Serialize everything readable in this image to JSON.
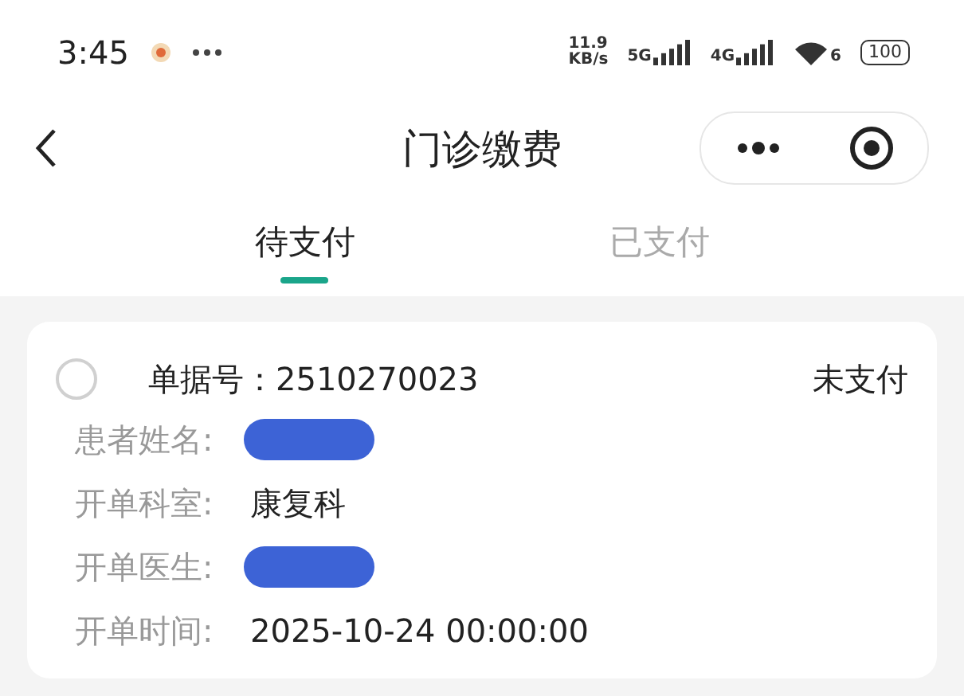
{
  "status_bar": {
    "time": "3:45",
    "speed": "11.9",
    "speed_unit": "KB/s",
    "sim_1": "5G",
    "sim_2": "4G",
    "wifi_badge": "6",
    "battery": "100"
  },
  "nav": {
    "title": "门诊缴费"
  },
  "tabs": [
    {
      "label": "待支付",
      "selected": true
    },
    {
      "label": "已支付",
      "selected": false
    }
  ],
  "bill": {
    "checked": false,
    "number_label": "单据号：",
    "number": "2510270023",
    "status": "未支付",
    "fields": [
      {
        "label": "患者姓名:",
        "kind": "redacted"
      },
      {
        "label": "开单科室:",
        "kind": "text",
        "value": "康复科"
      },
      {
        "label": "开单医生:",
        "kind": "redacted"
      },
      {
        "label": "开单时间:",
        "kind": "text",
        "value": "2025-10-24 00:00:00"
      }
    ]
  }
}
